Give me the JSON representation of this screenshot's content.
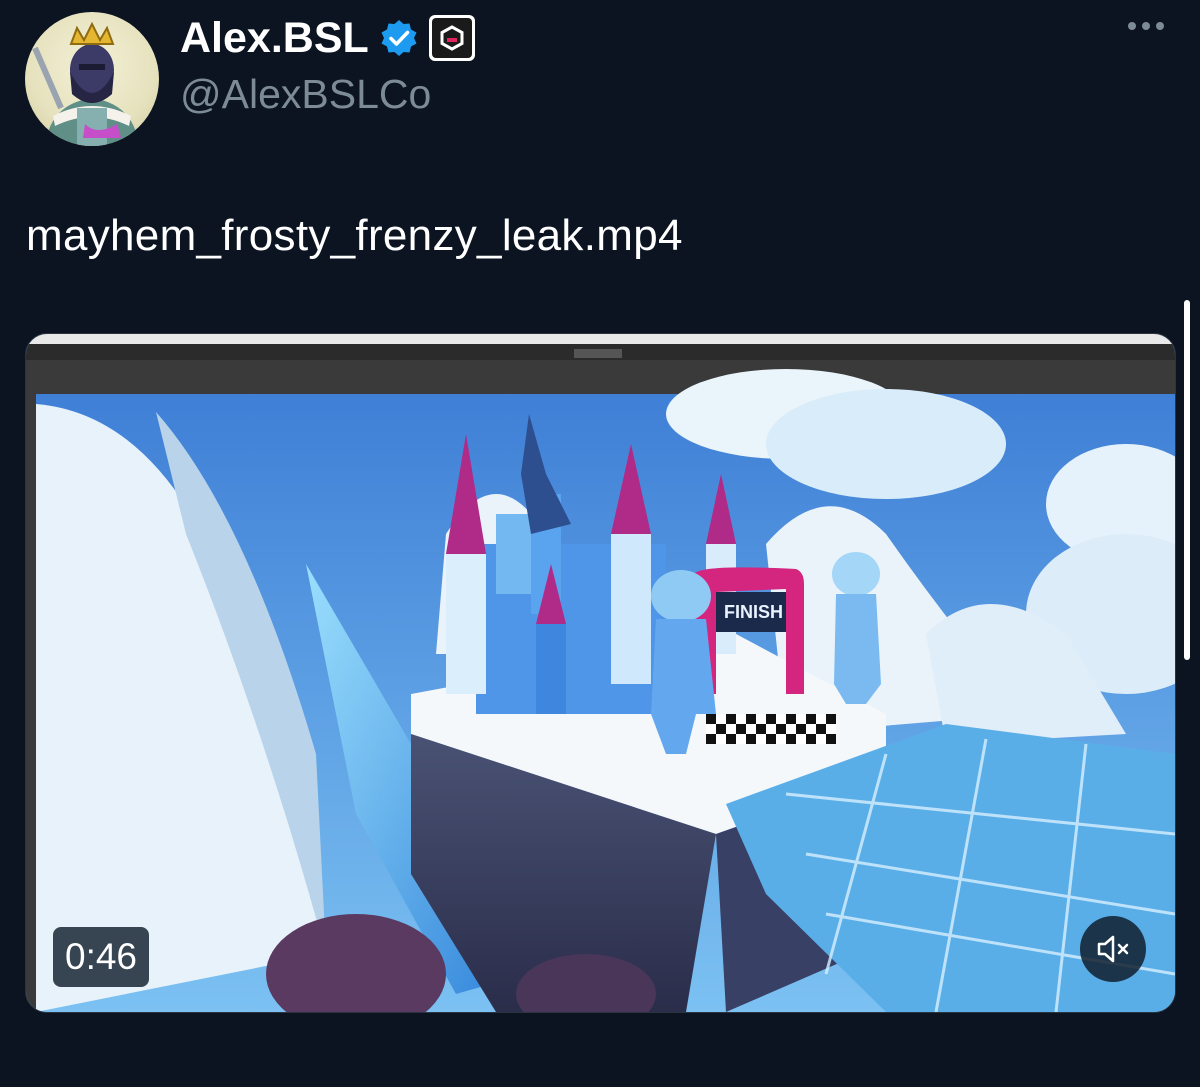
{
  "author": {
    "display_name": "Alex.BSL",
    "handle": "@AlexBSLCo",
    "verified_color": "#1d9bf0"
  },
  "tweet": {
    "text": "mayhem_frosty_frenzy_leak.mp4"
  },
  "video": {
    "duration": "0:46",
    "muted": true,
    "gate_text": "FINISH"
  },
  "icons": {
    "more": "more-options-icon",
    "mute": "speaker-muted-icon",
    "verified": "verified-badge-icon",
    "affiliate": "affiliate-logo-icon"
  }
}
